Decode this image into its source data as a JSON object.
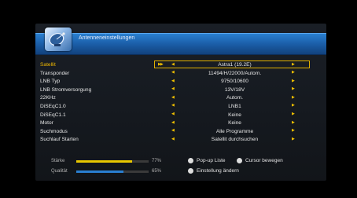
{
  "header": {
    "title": "Antenneneinstellungen"
  },
  "settings": [
    {
      "label": "Satellit",
      "value": "Astra1 (19.2E)",
      "selected": true
    },
    {
      "label": "Transponder",
      "value": "11494/H/22000/Autom."
    },
    {
      "label": "LNB Typ",
      "value": "9750/10600"
    },
    {
      "label": "LNB Stromversorgung",
      "value": "13V/18V"
    },
    {
      "label": "22KHz",
      "value": "Autom."
    },
    {
      "label": "DiSEqC1.0",
      "value": "LNB1"
    },
    {
      "label": "DiSEqC1.1",
      "value": "Keine"
    },
    {
      "label": "Motor",
      "value": "Keine"
    },
    {
      "label": "Suchmodus",
      "value": "Alle Programme"
    },
    {
      "label": "Suchlauf Starten",
      "value": "Satellit durchsuchen"
    }
  ],
  "meters": {
    "strength": {
      "label": "Stärke",
      "percent_text": "77%",
      "level": 0.77,
      "color": "#e8c800"
    },
    "quality": {
      "label": "Qualität",
      "percent_text": "65%",
      "level": 0.65,
      "color": "#2a7fd0"
    }
  },
  "hints": {
    "popup": "Pop-up Liste",
    "cursor": "Cursor bewegen",
    "edit": "Einstellung ändern"
  }
}
